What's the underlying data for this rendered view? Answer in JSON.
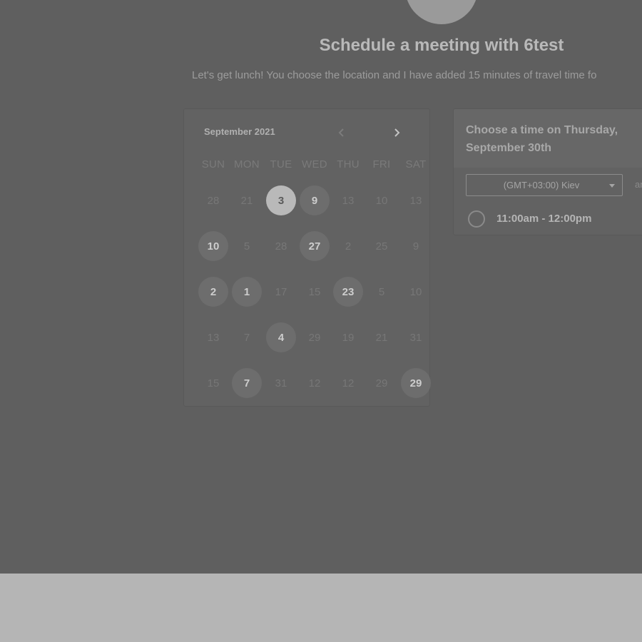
{
  "header": {
    "title": "Schedule a meeting with 6test",
    "subtitle": "Let's get lunch! You choose the location and I have added 15 minutes of travel time fo"
  },
  "calendar": {
    "month_label": "September 2021",
    "prev_icon": "chevron-left-icon",
    "next_icon": "chevron-right-icon",
    "weekdays": [
      "SUN",
      "MON",
      "TUE",
      "WED",
      "THU",
      "FRI",
      "SAT"
    ],
    "weeks": [
      [
        {
          "d": "28",
          "s": "off"
        },
        {
          "d": "21",
          "s": "off"
        },
        {
          "d": "3",
          "s": "sel"
        },
        {
          "d": "9",
          "s": "on"
        },
        {
          "d": "13",
          "s": "off"
        },
        {
          "d": "10",
          "s": "off"
        },
        {
          "d": "13",
          "s": "off"
        }
      ],
      [
        {
          "d": "10",
          "s": "on"
        },
        {
          "d": "5",
          "s": "off"
        },
        {
          "d": "28",
          "s": "off"
        },
        {
          "d": "27",
          "s": "on"
        },
        {
          "d": "2",
          "s": "off"
        },
        {
          "d": "25",
          "s": "off"
        },
        {
          "d": "9",
          "s": "off"
        }
      ],
      [
        {
          "d": "2",
          "s": "on"
        },
        {
          "d": "1",
          "s": "on"
        },
        {
          "d": "17",
          "s": "off"
        },
        {
          "d": "15",
          "s": "off"
        },
        {
          "d": "23",
          "s": "on"
        },
        {
          "d": "5",
          "s": "off"
        },
        {
          "d": "10",
          "s": "off"
        }
      ],
      [
        {
          "d": "13",
          "s": "off"
        },
        {
          "d": "7",
          "s": "off"
        },
        {
          "d": "4",
          "s": "on"
        },
        {
          "d": "29",
          "s": "off"
        },
        {
          "d": "19",
          "s": "off"
        },
        {
          "d": "21",
          "s": "off"
        },
        {
          "d": "31",
          "s": "off"
        }
      ],
      [
        {
          "d": "15",
          "s": "off"
        },
        {
          "d": "7",
          "s": "on"
        },
        {
          "d": "31",
          "s": "off"
        },
        {
          "d": "12",
          "s": "off"
        },
        {
          "d": "12",
          "s": "off"
        },
        {
          "d": "29",
          "s": "off"
        },
        {
          "d": "29",
          "s": "on"
        }
      ]
    ]
  },
  "time_panel": {
    "title": "Choose a time on Thursday, September 30th",
    "timezone": "(GMT+03:00) Kiev",
    "timezone_icon": "caret-down-icon",
    "am_label": "am",
    "slots": [
      {
        "label": "11:00am - 12:00pm"
      }
    ]
  },
  "colors": {
    "overlay": "#5f5f5f",
    "card": "#626262",
    "footer": "#b5b5b5"
  }
}
